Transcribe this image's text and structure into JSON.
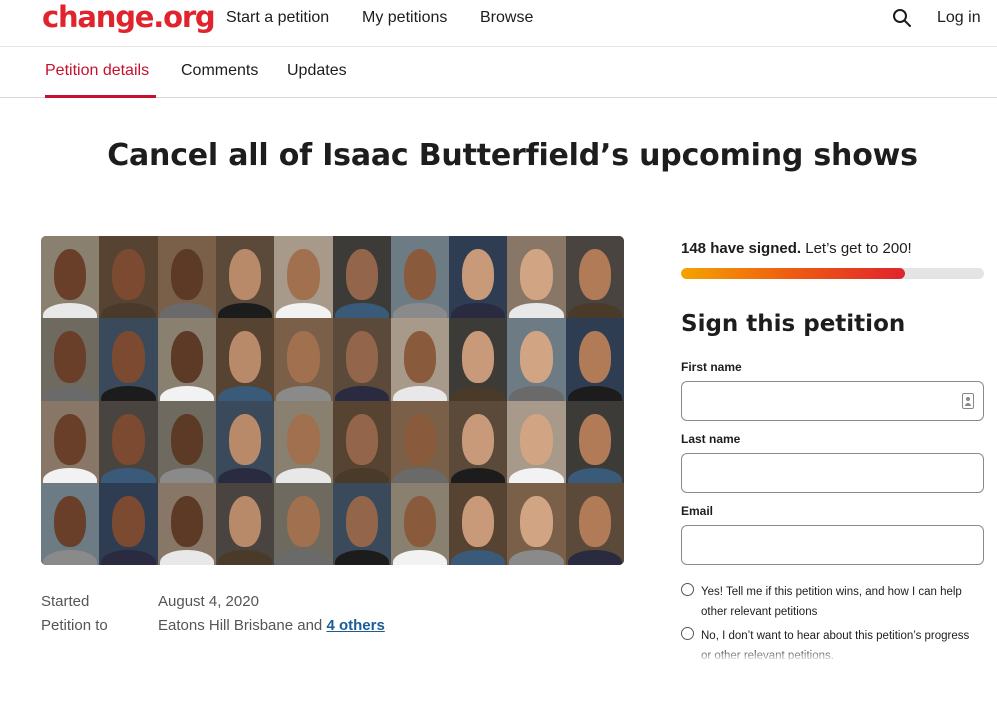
{
  "nav": {
    "logo": "change.org",
    "links": [
      "Start a petition",
      "My petitions",
      "Browse"
    ],
    "search_icon": "search-icon",
    "login": "Log in"
  },
  "tabs": [
    "Petition details",
    "Comments",
    "Updates"
  ],
  "petition": {
    "title": "Cancel all of Isaac Butterfield’s upcoming shows",
    "started_label": "Started",
    "started_value": "August 4, 2020",
    "to_label": "Petition to",
    "to_value": "Eatons Hill Brisbane and",
    "to_link": "4 others"
  },
  "signatures": {
    "count_text": "148 have signed.",
    "goal_text": "Let’s get to 200!",
    "progress_fraction": 0.74
  },
  "form": {
    "heading": "Sign this petition",
    "first_name_label": "First name",
    "last_name_label": "Last name",
    "email_label": "Email",
    "first_name_value": "",
    "last_name_value": "",
    "email_value": "",
    "opt_in": "Yes! Tell me if this petition wins, and how I can help other relevant petitions",
    "opt_out": "No, I don’t want to hear about this petition’s progress or other relevant petitions."
  },
  "colors": {
    "brand": "#e0242d",
    "active_tab": "#c8102e",
    "link": "#1a5c96",
    "progress_start": "#f5a300",
    "progress_end": "#e0242d"
  }
}
